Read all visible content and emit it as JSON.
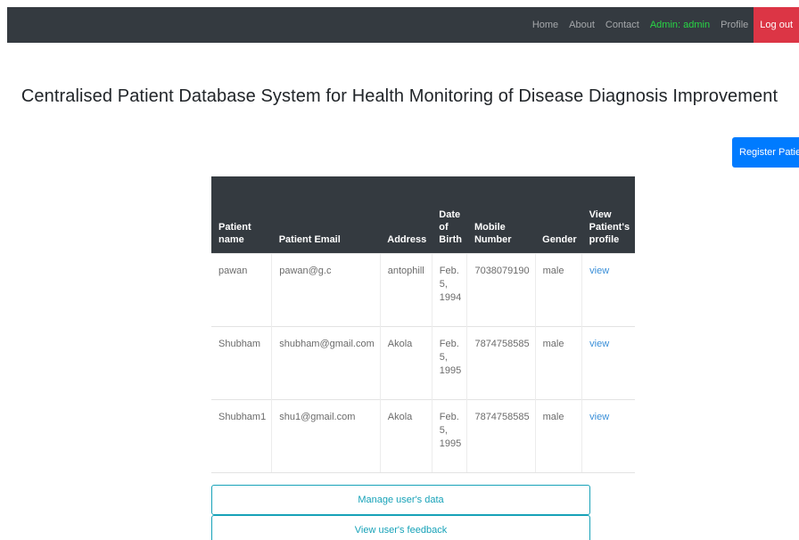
{
  "nav": {
    "home": "Home",
    "about": "About",
    "contact": "Contact",
    "admin": "Admin: admin",
    "profile": "Profile",
    "logout": "Log out"
  },
  "page_title": "Centralised Patient Database System for Health Monitoring of Disease Diagnosis Improvement",
  "register_button": "Register Patient",
  "table": {
    "headers": [
      "Patient name",
      "Patient Email",
      "Address",
      "Date of Birth",
      "Mobile Number",
      "Gender",
      "View Patient's profile"
    ],
    "rows": [
      {
        "name": "pawan",
        "email": "pawan@g.c",
        "address": "antophill",
        "dob": "Feb. 5, 1994",
        "mobile": "7038079190",
        "gender": "male",
        "view": "view"
      },
      {
        "name": "Shubham",
        "email": "shubham@gmail.com",
        "address": "Akola",
        "dob": "Feb. 5, 1995",
        "mobile": "7874758585",
        "gender": "male",
        "view": "view"
      },
      {
        "name": "Shubham1",
        "email": "shu1@gmail.com",
        "address": "Akola",
        "dob": "Feb. 5, 1995",
        "mobile": "7874758585",
        "gender": "male",
        "view": "view"
      }
    ]
  },
  "buttons": {
    "manage": "Manage user's data",
    "feedback": "View user's feedback"
  },
  "colors": {
    "navbar": "#343a40",
    "admin_text": "#28d745",
    "logout_bg": "#dc3545",
    "primary": "#007bff",
    "outline": "#17a2b8",
    "link": "#3a8fd8"
  }
}
